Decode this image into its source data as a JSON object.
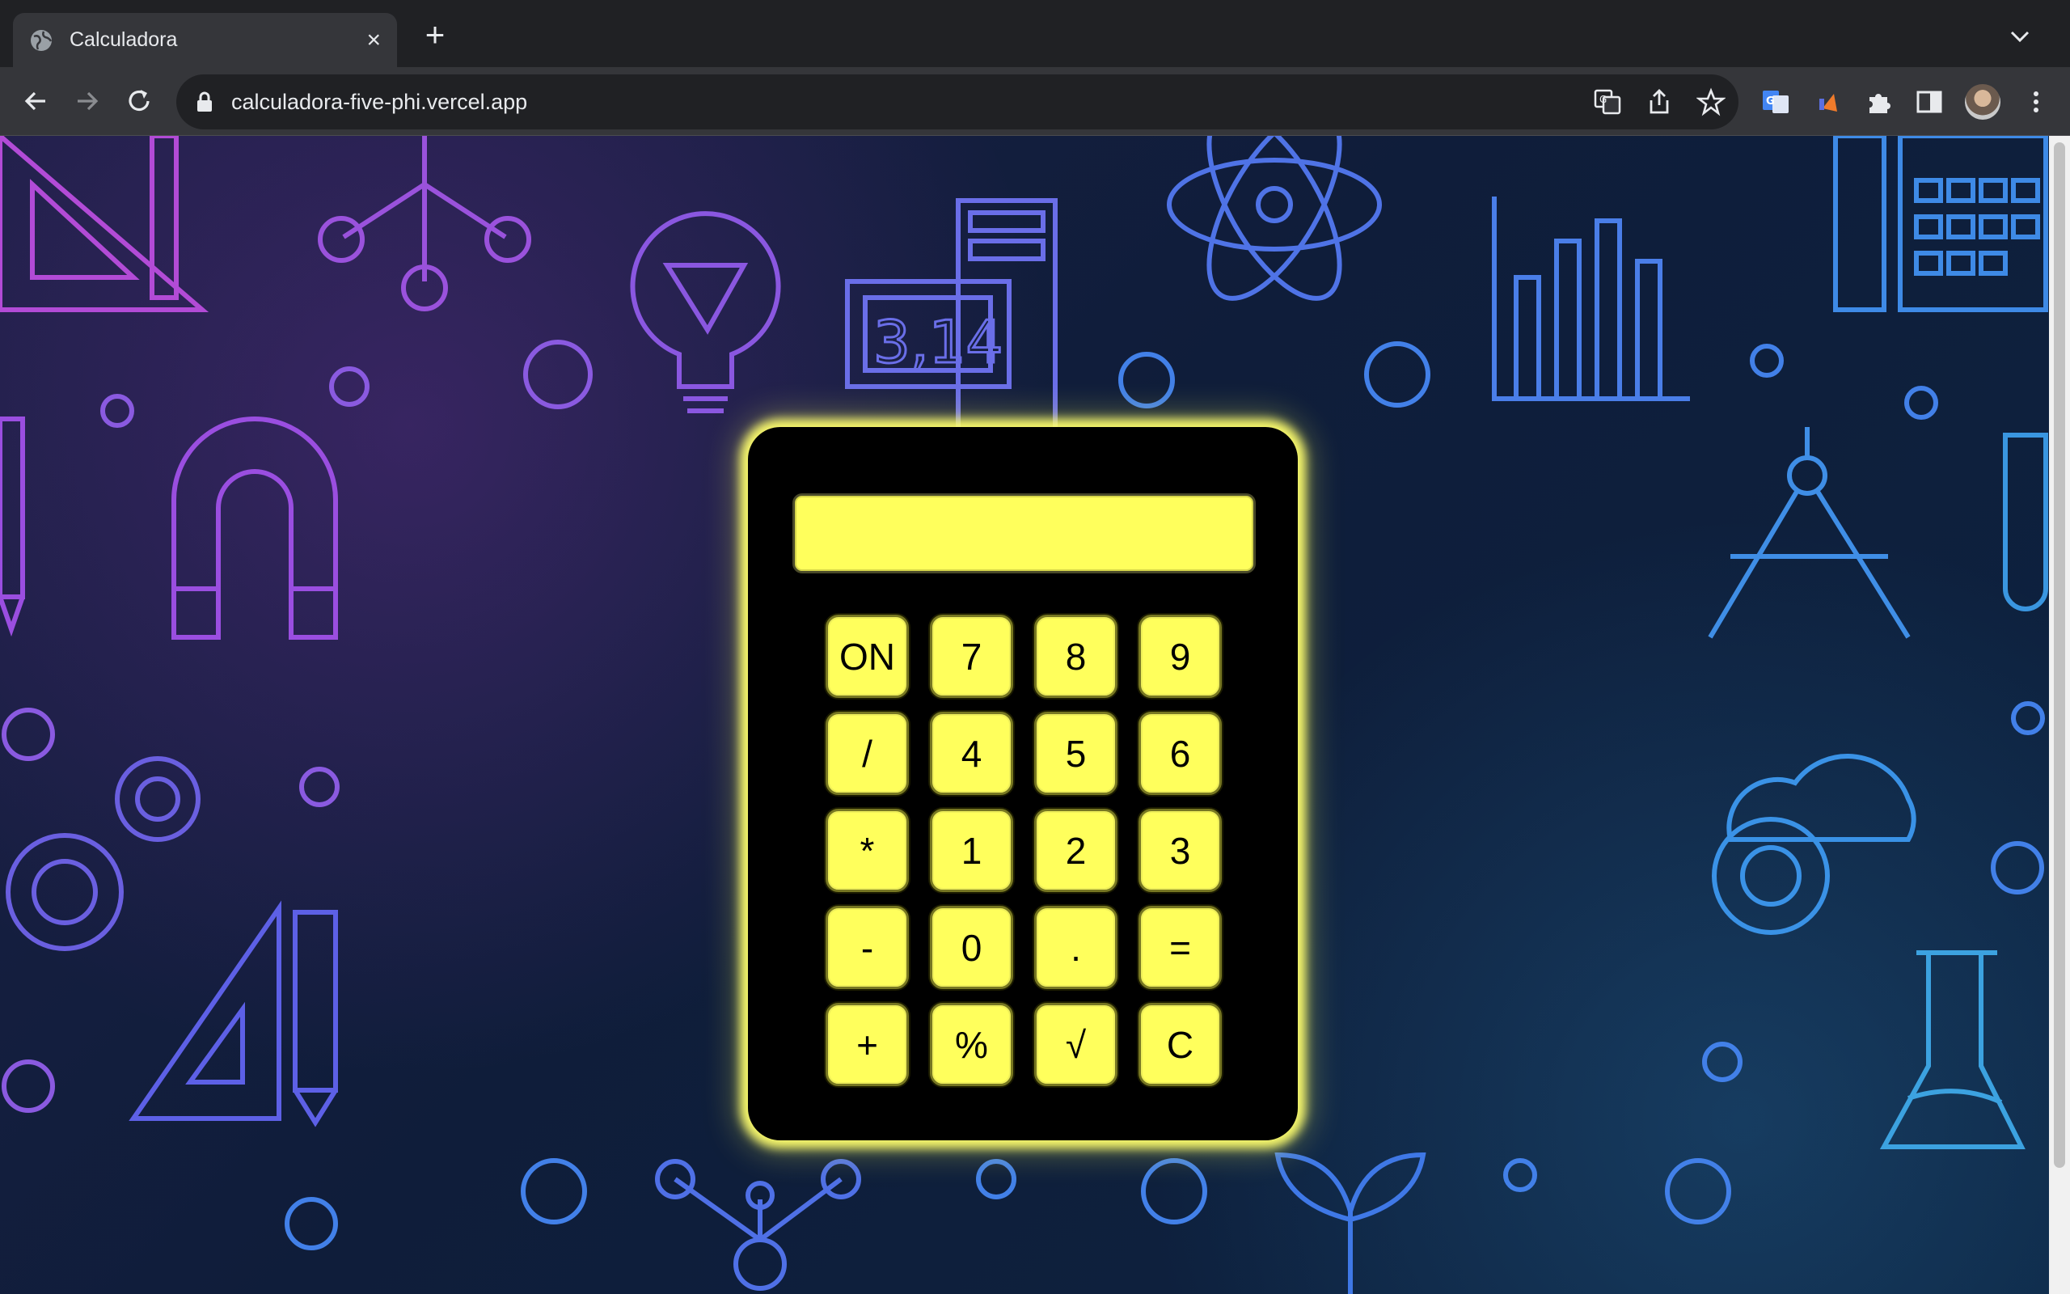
{
  "browser": {
    "tab_title": "Calculadora",
    "tab_close": "×",
    "new_tab": "+",
    "url": "calculadora-five-phi.vercel.app"
  },
  "calculator": {
    "display_value": "",
    "keys": [
      [
        "ON",
        "7",
        "8",
        "9"
      ],
      [
        "/",
        "4",
        "5",
        "6"
      ],
      [
        "*",
        "1",
        "2",
        "3"
      ],
      [
        "-",
        "0",
        ".",
        "="
      ],
      [
        "+",
        "%",
        "√",
        "C"
      ]
    ]
  },
  "colors": {
    "calculator_accent": "#ffff5c",
    "calculator_body": "#000000",
    "chrome_dark": "#202124",
    "chrome_toolbar": "#35363a"
  },
  "icons": {
    "back": "back-arrow-icon",
    "forward": "forward-arrow-icon",
    "reload": "reload-icon",
    "lock": "lock-icon",
    "translate": "translate-icon",
    "share": "share-icon",
    "bookmark": "star-icon",
    "extensions": "puzzle-icon",
    "side_panel": "side-panel-icon",
    "menu": "kebab-menu-icon"
  }
}
